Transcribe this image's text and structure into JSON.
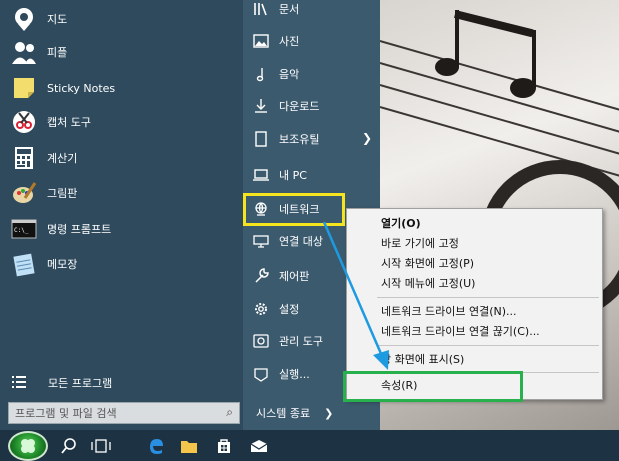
{
  "apps": [
    {
      "label": "지도",
      "icon": "map-pin-icon"
    },
    {
      "label": "피플",
      "icon": "people-icon"
    },
    {
      "label": "Sticky Notes",
      "icon": "sticky-note-icon"
    },
    {
      "label": "캡처 도구",
      "icon": "scissors-icon"
    },
    {
      "label": "계산기",
      "icon": "calculator-icon"
    },
    {
      "label": "그림판",
      "icon": "paint-palette-icon"
    },
    {
      "label": "명령 프롬프트",
      "icon": "command-prompt-icon"
    },
    {
      "label": "메모장",
      "icon": "notepad-icon"
    }
  ],
  "all_programs_label": "모든 프로그램",
  "search_placeholder": "프로그램 및 파일 검색",
  "places": [
    {
      "label": "문서",
      "icon": "documents-icon"
    },
    {
      "label": "사진",
      "icon": "pictures-icon"
    },
    {
      "label": "음악",
      "icon": "music-note-icon"
    },
    {
      "label": "다운로드",
      "icon": "download-icon"
    },
    {
      "label": "보조유틸",
      "icon": "accessories-icon"
    },
    {
      "label": "내 PC",
      "icon": "computer-icon"
    },
    {
      "label": "네트워크",
      "icon": "network-icon"
    },
    {
      "label": "연결 대상",
      "icon": "connect-to-icon"
    },
    {
      "label": "제어판",
      "icon": "control-panel-icon"
    },
    {
      "label": "설정",
      "icon": "settings-gear-icon"
    },
    {
      "label": "관리 도구",
      "icon": "admin-tools-icon"
    },
    {
      "label": "실행...",
      "icon": "run-icon"
    }
  ],
  "shutdown_label": "시스템 종료",
  "context_menu": {
    "open": "열기(O)",
    "pin_quick": "바로 가기에 고정",
    "pin_start_screen": "시작 화면에 고정(P)",
    "pin_start_menu": "시작 메뉴에 고정(U)",
    "map_drive": "네트워크 드라이브 연결(N)...",
    "disconnect_drive": "네트워크 드라이브 연결 끊기(C)...",
    "show_desktop": "탕 화면에 표시(S)",
    "properties": "속성(R)"
  },
  "colors": {
    "start_left": "#2e4a5c",
    "start_right": "#3b5a6d",
    "highlight_yellow": "#f5e41e",
    "highlight_green": "#27b04b",
    "arrow_blue": "#1e9be0"
  }
}
